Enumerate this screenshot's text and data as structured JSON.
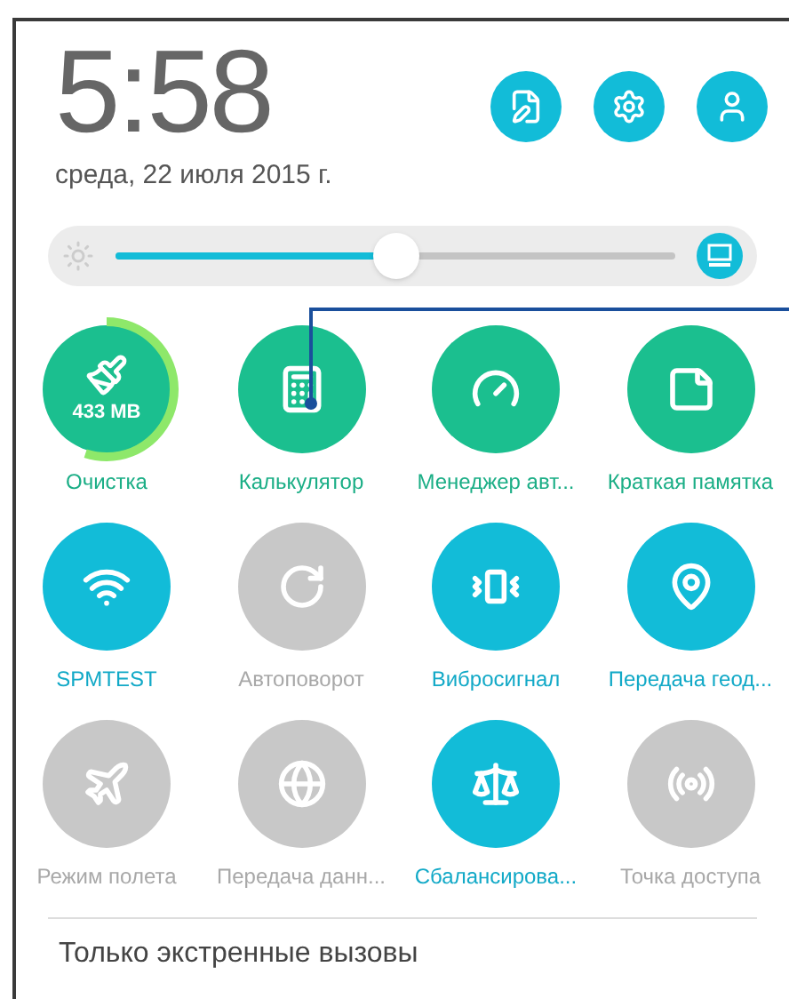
{
  "clock": {
    "time": "5:58",
    "date": "среда, 22 июля 2015 г."
  },
  "header_buttons": [
    {
      "kind": "notes"
    },
    {
      "kind": "settings"
    },
    {
      "kind": "profile"
    }
  ],
  "brightness": {
    "level": 0.5,
    "auto": true
  },
  "tiles": [
    {
      "label": "Очистка",
      "kind": "shortcut",
      "badge": "433 MB",
      "level": 0.55
    },
    {
      "label": "Калькулятор",
      "kind": "shortcut"
    },
    {
      "label": "Менеджер авт...",
      "kind": "shortcut"
    },
    {
      "label": "Краткая памятка",
      "kind": "shortcut"
    },
    {
      "label": "SPMTEST",
      "kind": "toggle",
      "on": true
    },
    {
      "label": "Автоповорот",
      "kind": "toggle",
      "on": false
    },
    {
      "label": "Вибросигнал",
      "kind": "toggle",
      "on": true
    },
    {
      "label": "Передача геод...",
      "kind": "toggle",
      "on": true
    },
    {
      "label": "Режим полета",
      "kind": "toggle",
      "on": false
    },
    {
      "label": "Передача данн...",
      "kind": "toggle",
      "on": false
    },
    {
      "label": "Сбалансирова...",
      "kind": "toggle",
      "on": true
    },
    {
      "label": "Точка доступа",
      "kind": "toggle",
      "on": false
    }
  ],
  "footer": "Только экстренные вызовы"
}
